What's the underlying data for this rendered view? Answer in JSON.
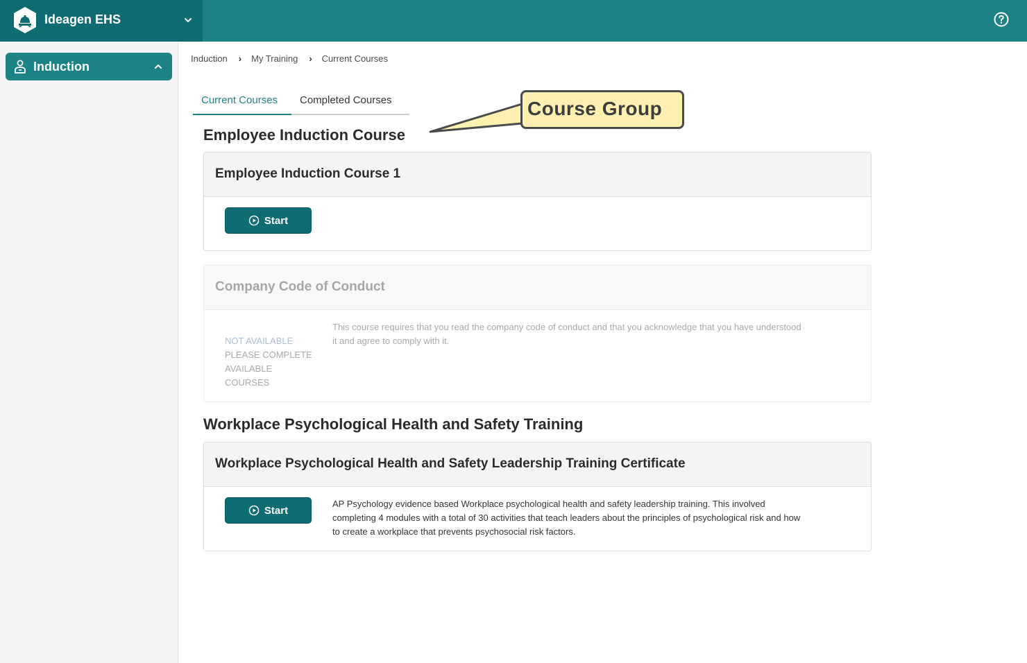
{
  "app": {
    "name": "Ideagen EHS",
    "brand_color": "#0f6c72",
    "topbar_color": "#1d8286"
  },
  "sidebar": {
    "items": [
      {
        "label": "Induction",
        "icon": "person-badge-icon",
        "expanded": true
      }
    ]
  },
  "breadcrumb": [
    "Induction",
    "My Training",
    "Current Courses"
  ],
  "tabs": [
    {
      "label": "Current Courses",
      "active": true
    },
    {
      "label": "Completed Courses",
      "active": false
    }
  ],
  "callout": {
    "text": "Course Group"
  },
  "groups": [
    {
      "title": "Employee Induction Course",
      "courses": [
        {
          "title": "Employee Induction Course 1",
          "action_label": "Start",
          "available": true,
          "description": ""
        },
        {
          "title": "Company Code of Conduct",
          "available": false,
          "status": "NOT AVAILABLE",
          "status_message": "PLEASE COMPLETE AVAILABLE COURSES",
          "description": "This course requires that you read the company code of conduct and that you acknowledge that you have understood it and agree to comply with it."
        }
      ]
    },
    {
      "title": "Workplace Psychological Health and Safety Training",
      "courses": [
        {
          "title": "Workplace Psychological Health and Safety Leadership Training Certificate",
          "action_label": "Start",
          "available": true,
          "description": "AP Psychology evidence based Workplace psychological health and safety leadership training. This involved completing 4 modules with a total of 30 activities that teach leaders about the principles of psychological risk and how to create a workplace that prevents psychosocial risk factors."
        }
      ]
    }
  ]
}
